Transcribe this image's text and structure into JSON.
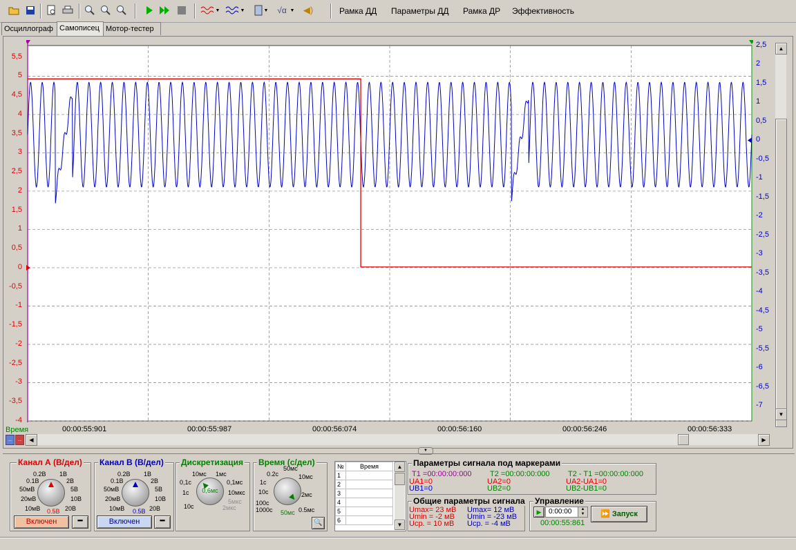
{
  "menu": [
    "Рамка ДД",
    "Параметры ДД",
    "Рамка ДР",
    "Эффективность"
  ],
  "toolbar_icons": [
    "open-icon",
    "save-icon",
    "preview-icon",
    "print-icon",
    "zoom-in-icon",
    "zoom-out-icon",
    "zoom-fit-icon",
    "play-icon",
    "fast-forward-icon",
    "stop-icon",
    "filter-a-icon",
    "filter-b-icon",
    "calculator-icon",
    "formula-icon",
    "sound-icon"
  ],
  "tabs": [
    "Осциллограф",
    "Самописец",
    "Мотор-тестер"
  ],
  "active_tab": 1,
  "colors": {
    "channel_a": "#e00000",
    "channel_b": "#0000c0",
    "grid": "#808080",
    "plot_bg": "#ffffff"
  },
  "chart_data": {
    "type": "line",
    "xlabel": "Время",
    "x_ticks": [
      "00:00:55:901",
      "00:00:55:987",
      "00:00:56:074",
      "00:00:56:160",
      "00:00:56:246",
      "00:00:56:333"
    ],
    "y_left_ticks": [
      "5,5",
      "5",
      "4,5",
      "4",
      "3,5",
      "3",
      "2,5",
      "2",
      "1,5",
      "1",
      "0,5",
      "0",
      "-0,5",
      "-1",
      "-1,5",
      "-2",
      "-2,5",
      "-3",
      "-3,5",
      "-4"
    ],
    "y_right_ticks": [
      "2,5",
      "2",
      "1,5",
      "1",
      "0,5",
      "0",
      "-0,5",
      "-1",
      "-1,5",
      "-2",
      "-2,5",
      "-3",
      "-3,5",
      "-4",
      "-4,5",
      "-5",
      "-5,5",
      "-6",
      "-6,5",
      "-7"
    ],
    "y_left_range": [
      -4,
      5.8
    ],
    "y_right_range": [
      -7.4,
      2.5
    ],
    "grid": true,
    "series": [
      {
        "channel": "A",
        "color": "#e00000",
        "step_time": "00:00:56:074",
        "level_before": 4.93,
        "level_after": 0.02
      },
      {
        "channel": "B",
        "color": "#0000c0",
        "waveform": "periodic oscillation",
        "min": -1.5,
        "max": 1.5,
        "cycles": 62,
        "gap_positions": [
          "00:00:55:901",
          "00:00:56:200"
        ]
      }
    ]
  },
  "channel_a": {
    "title": "Канал А (В/дел)",
    "ticks": [
      "0.2В",
      "1В",
      "0.1В",
      "2В",
      "50мВ",
      "5В",
      "20мВ",
      "10В",
      "10мВ",
      "20В"
    ],
    "value": "0.5В",
    "button": "Включен"
  },
  "channel_b": {
    "title": "Канал В (В/дел)",
    "ticks": [
      "0.2В",
      "1В",
      "0.1В",
      "2В",
      "50мВ",
      "5В",
      "20мВ",
      "10В",
      "10мВ",
      "20В"
    ],
    "value": "0.5В",
    "button": "Включен"
  },
  "discretization": {
    "title": "Дискретизация",
    "ticks": [
      "10мс",
      "1мс",
      "0,1с",
      "0,1мс",
      "1с",
      "10мкс",
      "10с",
      "5мкс",
      "2мкс"
    ],
    "value": "0,6мс"
  },
  "time": {
    "title": "Время (с/дел)",
    "ticks": [
      "0.2с",
      "50мс",
      "1с",
      "10мс",
      "10с",
      "2мс",
      "100с",
      "1000с",
      "0.5мс"
    ],
    "value": "50мс"
  },
  "table": {
    "col_num": "№",
    "col_time": "Время",
    "rows": [
      "1",
      "2",
      "3",
      "4",
      "5",
      "6"
    ]
  },
  "markers": {
    "title": "Параметры сигнала под маркерами",
    "t1": "T1 =00:00:00:000",
    "ua1": "UA1=0",
    "ub1": "UB1=0",
    "t2": "T2 =00:00:00:000",
    "ua2": "UA2=0",
    "ub2": "UB2=0",
    "dt": "T2 - T1 =00:00:00:000",
    "dua": "UA2-UA1=0",
    "dub": "UB2-UB1=0"
  },
  "general": {
    "title": "Общие параметры сигнала",
    "a_max": "Umax= 23 мВ",
    "a_min": "Umin = -2 мВ",
    "a_avg": "Uср. = 10 мВ",
    "b_max": "Umax= 12 мВ",
    "b_min": "Umin = -23 мВ",
    "b_avg": "Uср. = -4 мВ"
  },
  "control": {
    "title": "Управление",
    "time_value": "0:00:00",
    "start_button": "Запуск",
    "clock": "00:00:55:861"
  }
}
